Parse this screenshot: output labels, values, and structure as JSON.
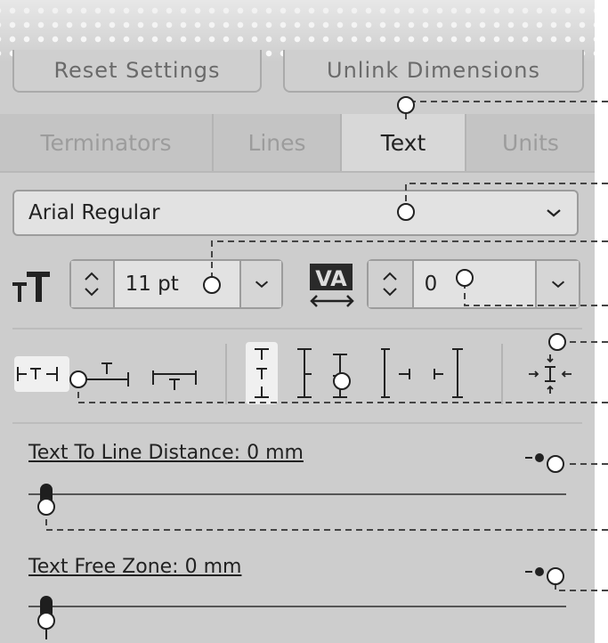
{
  "top_buttons": {
    "reset": "Reset Settings",
    "unlink": "Unlink Dimensions"
  },
  "tabs": [
    {
      "label": "Terminators",
      "active": false
    },
    {
      "label": "Lines",
      "active": false
    },
    {
      "label": "Text",
      "active": true
    },
    {
      "label": "Units",
      "active": false
    }
  ],
  "font": {
    "selected": "Arial Regular"
  },
  "font_size": {
    "value": "11 pt"
  },
  "tracking": {
    "value": "0"
  },
  "sliders": {
    "text_to_line": {
      "label": "Text To Line Distance:  0 mm",
      "value": 0
    },
    "free_zone": {
      "label": "Text Free Zone:  0 mm",
      "value": 0
    }
  },
  "icons": {
    "font_size": "font-size-icon",
    "tracking": "tracking-va-icon",
    "chevron": "chevron-down-icon",
    "stepper": "stepper-up-down-icon"
  },
  "colors": {
    "panel_bg": "#cdcdcd",
    "active_tab": "#d8d8d8",
    "callout_line": "#444444"
  }
}
